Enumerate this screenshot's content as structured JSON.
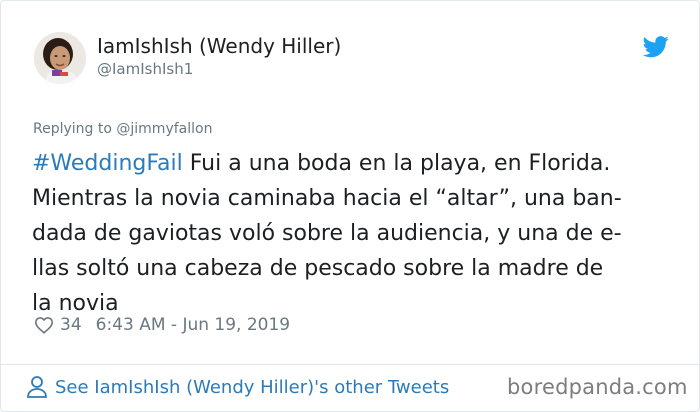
{
  "author": {
    "display_name": "IamIshIsh (Wendy Hiller)",
    "handle": "@IamIshIsh1"
  },
  "replying_to": {
    "prefix": "Replying to ",
    "mention": "@jimmyfallon"
  },
  "tweet": {
    "hashtag": "#WeddingFail",
    "lines": [
      " Fui a una boda en la playa, en Florida.",
      "Mientras la novia caminaba hacia el “altar”, una ban-",
      "dada de gaviotas voló sobre la audiencia, y una de e-",
      "llas soltó una cabeza de pescado sobre la madre de",
      "la novia"
    ]
  },
  "meta": {
    "likes": "34",
    "timestamp": "6:43 AM - Jun 19, 2019"
  },
  "footer": {
    "other_tweets_label": "See IamIshIsh (Wendy Hiller)'s other Tweets",
    "watermark": "boredpanda.com"
  },
  "icons": {
    "brand": "twitter-bird-icon",
    "like": "heart-icon",
    "profile": "person-icon"
  },
  "colors": {
    "link": "#2b7bb9",
    "muted": "#697882",
    "text": "#1c2022",
    "twitter_blue": "#1da1f2"
  }
}
